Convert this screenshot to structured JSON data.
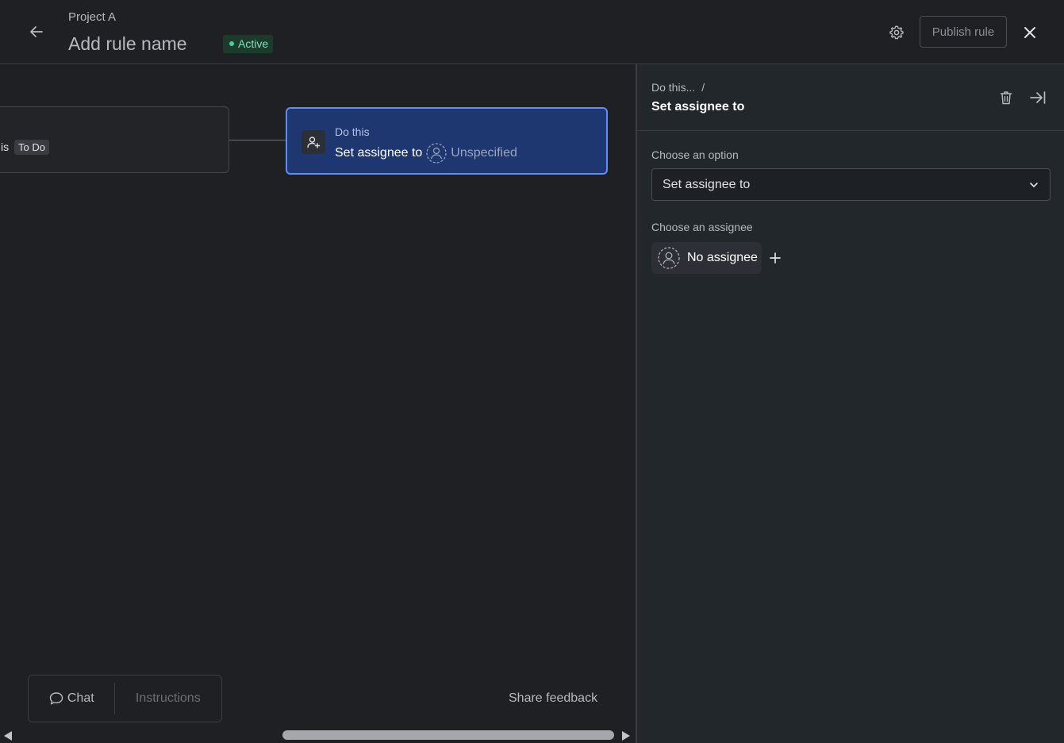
{
  "header": {
    "project_name": "Project A",
    "rule_title": "Add rule name",
    "status": "Active",
    "publish_label": "Publish rule",
    "icons": {
      "back": "arrow-left-icon",
      "settings": "gear-icon",
      "close": "close-icon"
    }
  },
  "canvas": {
    "trigger": {
      "text_prefix": "is",
      "status_value": "To Do"
    },
    "action": {
      "kicker": "Do this",
      "label": "Set assignee to",
      "value": "Unspecified",
      "icon": "person-add-icon"
    }
  },
  "bottom_bar": {
    "chat_label": "Chat",
    "instructions_label": "Instructions",
    "share_feedback_label": "Share feedback"
  },
  "panel": {
    "breadcrumb": "Do this...",
    "breadcrumb_sep": "/",
    "title": "Set assignee to",
    "option_label": "Choose an option",
    "option_value": "Set assignee to",
    "assignee_label": "Choose an assignee",
    "assignee_value": "No assignee",
    "icons": {
      "delete": "trash-icon",
      "collapse": "collapse-panel-icon",
      "add": "plus-icon"
    }
  },
  "colors": {
    "accent": "#5d8ef8",
    "action_bg": "#1e3770",
    "active_green": "#4bce97",
    "background": "#1f2023"
  }
}
